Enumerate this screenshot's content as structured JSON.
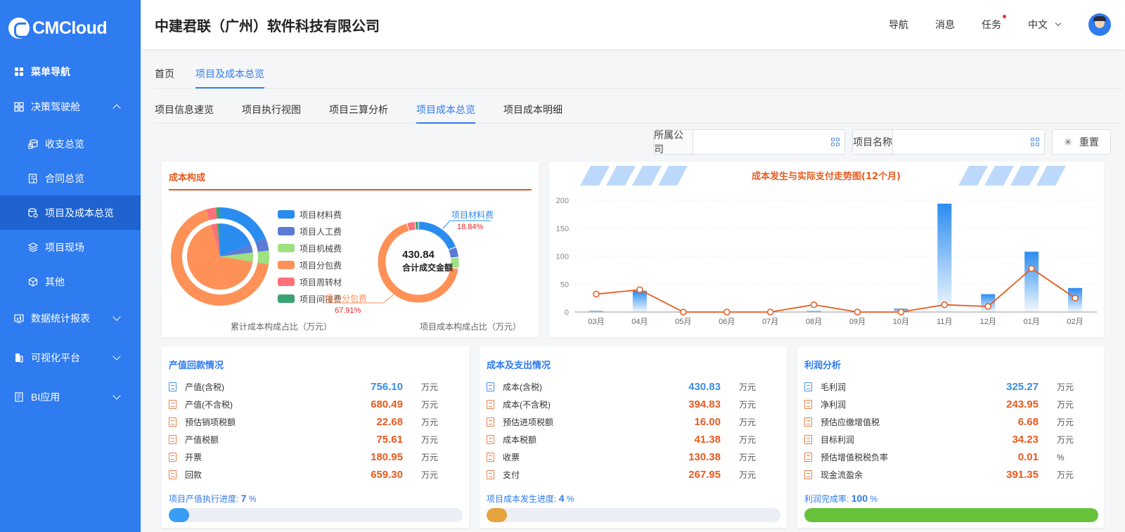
{
  "brand": {
    "name": "CMCloud"
  },
  "sidebar": {
    "items": [
      {
        "label": "菜单导航",
        "icon": "grid-icon",
        "level": "top"
      },
      {
        "label": "决策驾驶舱",
        "icon": "dashboard-icon",
        "level": "top",
        "expanded": true
      },
      {
        "label": "收支总览",
        "icon": "coins-icon",
        "level": "sub"
      },
      {
        "label": "合同总览",
        "icon": "contract-icon",
        "level": "sub"
      },
      {
        "label": "项目及成本总览",
        "icon": "database-icon",
        "level": "sub",
        "active": true
      },
      {
        "label": "项目现场",
        "icon": "layers-icon",
        "level": "sub"
      },
      {
        "label": "其他",
        "icon": "cube-icon",
        "level": "sub"
      },
      {
        "label": "数据统计报表",
        "icon": "report-icon",
        "level": "top",
        "expanded": false
      },
      {
        "label": "可视化平台",
        "icon": "building-icon",
        "level": "top",
        "expanded": false
      },
      {
        "label": "BI应用",
        "icon": "bi-icon",
        "level": "top",
        "expanded": false
      }
    ]
  },
  "header": {
    "company": "中建君联（广州）软件科技有限公司",
    "nav": "导航",
    "messages": "消息",
    "tasks": "任务",
    "language": "中文"
  },
  "tabs_primary": [
    {
      "label": "首页",
      "active": false
    },
    {
      "label": "项目及成本总览",
      "active": true
    }
  ],
  "tabs_secondary": [
    {
      "label": "项目信息速览",
      "active": false
    },
    {
      "label": "项目执行视图",
      "active": false
    },
    {
      "label": "项目三算分析",
      "active": false
    },
    {
      "label": "项目成本总览",
      "active": true
    },
    {
      "label": "项目成本明细",
      "active": false
    }
  ],
  "filters": {
    "company_label": "所属公司",
    "company_value": "",
    "project_label": "项目名称",
    "project_value": "",
    "reset_label": "重置"
  },
  "colors": {
    "primary": "#2f7bf0",
    "orange": "#e85a1e",
    "green": "#67c23a",
    "yellow": "#e6a23c"
  },
  "cost_composition": {
    "title": "成本构成",
    "caption_left": "累计成本构成占比（万元）",
    "caption_right": "项目成本构成占比（万元）",
    "center_value": "430.84",
    "center_label": "合计成交金额",
    "callout_top_name": "项目材料费",
    "callout_top_pct": "18.84%",
    "callout_bottom_name": "项目分包费",
    "callout_bottom_pct": "67.91%"
  },
  "chart_data": [
    {
      "type": "pie",
      "categories": [
        "项目材料费",
        "项目人工费",
        "项目机械费",
        "项目分包费",
        "项目周转材",
        "项目间接费"
      ],
      "values": [
        18.84,
        4.2,
        4.5,
        67.91,
        3.2,
        1.35
      ],
      "colors": [
        "#2b8cf0",
        "#5b7bd5",
        "#9fe080",
        "#fd9158",
        "#ff6f7a",
        "#3ba272"
      ]
    },
    {
      "type": "bar",
      "title": "成本发生与实际支付走势图(12个月)",
      "categories": [
        "03月",
        "04月",
        "05月",
        "06月",
        "07月",
        "08月",
        "09月",
        "10月",
        "11月",
        "12月",
        "01月",
        "02月"
      ],
      "ylim": [
        0,
        200
      ],
      "yticks": [
        0,
        50,
        100,
        150,
        200
      ],
      "series": [
        {
          "type": "bar",
          "values": [
            2,
            38,
            0,
            0,
            0,
            2,
            0,
            6,
            194,
            32,
            108,
            43
          ]
        },
        {
          "type": "line",
          "values": [
            32,
            40,
            0,
            0,
            0,
            13,
            0,
            0,
            13,
            10,
            78,
            25
          ]
        }
      ]
    }
  ],
  "panels": [
    {
      "title": "产值回款情况",
      "rows": [
        {
          "label": "产值(含税)",
          "value": "756.10",
          "unit": "万元",
          "highlight": true
        },
        {
          "label": "产值(不含税)",
          "value": "680.49",
          "unit": "万元"
        },
        {
          "label": "预估销项税额",
          "value": "22.68",
          "unit": "万元"
        },
        {
          "label": "产值税额",
          "value": "75.61",
          "unit": "万元"
        },
        {
          "label": "开票",
          "value": "180.95",
          "unit": "万元"
        },
        {
          "label": "回款",
          "value": "659.30",
          "unit": "万元"
        }
      ],
      "progress_label": "项目产值执行进度:",
      "progress_value": "7",
      "progress_unit": "%",
      "progress_fraction": 0.07,
      "progress_color": "#3a9df5"
    },
    {
      "title": "成本及支出情况",
      "rows": [
        {
          "label": "成本(含税)",
          "value": "430.83",
          "unit": "万元",
          "highlight": true
        },
        {
          "label": "成本(不含税)",
          "value": "394.83",
          "unit": "万元"
        },
        {
          "label": "预估进项税额",
          "value": "16.00",
          "unit": "万元"
        },
        {
          "label": "成本税额",
          "value": "41.38",
          "unit": "万元"
        },
        {
          "label": "收票",
          "value": "130.38",
          "unit": "万元"
        },
        {
          "label": "支付",
          "value": "267.95",
          "unit": "万元"
        }
      ],
      "progress_label": "项目成本发生进度:",
      "progress_value": "4",
      "progress_unit": "%",
      "progress_fraction": 0.04,
      "progress_color": "#e6a23c"
    },
    {
      "title": "利润分析",
      "rows": [
        {
          "label": "毛利润",
          "value": "325.27",
          "unit": "万元",
          "highlight": true
        },
        {
          "label": "净利润",
          "value": "243.95",
          "unit": "万元"
        },
        {
          "label": "预估应缴增值税",
          "value": "6.68",
          "unit": "万元"
        },
        {
          "label": "目标利润",
          "value": "34.23",
          "unit": "万元"
        },
        {
          "label": "预估增值税税负率",
          "value": "0.01",
          "unit": "%"
        },
        {
          "label": "现金流盈余",
          "value": "391.35",
          "unit": "万元"
        }
      ],
      "progress_label": "利润完成率:",
      "progress_value": "100",
      "progress_unit": "%",
      "progress_fraction": 1.0,
      "progress_color": "#67c23a"
    }
  ]
}
